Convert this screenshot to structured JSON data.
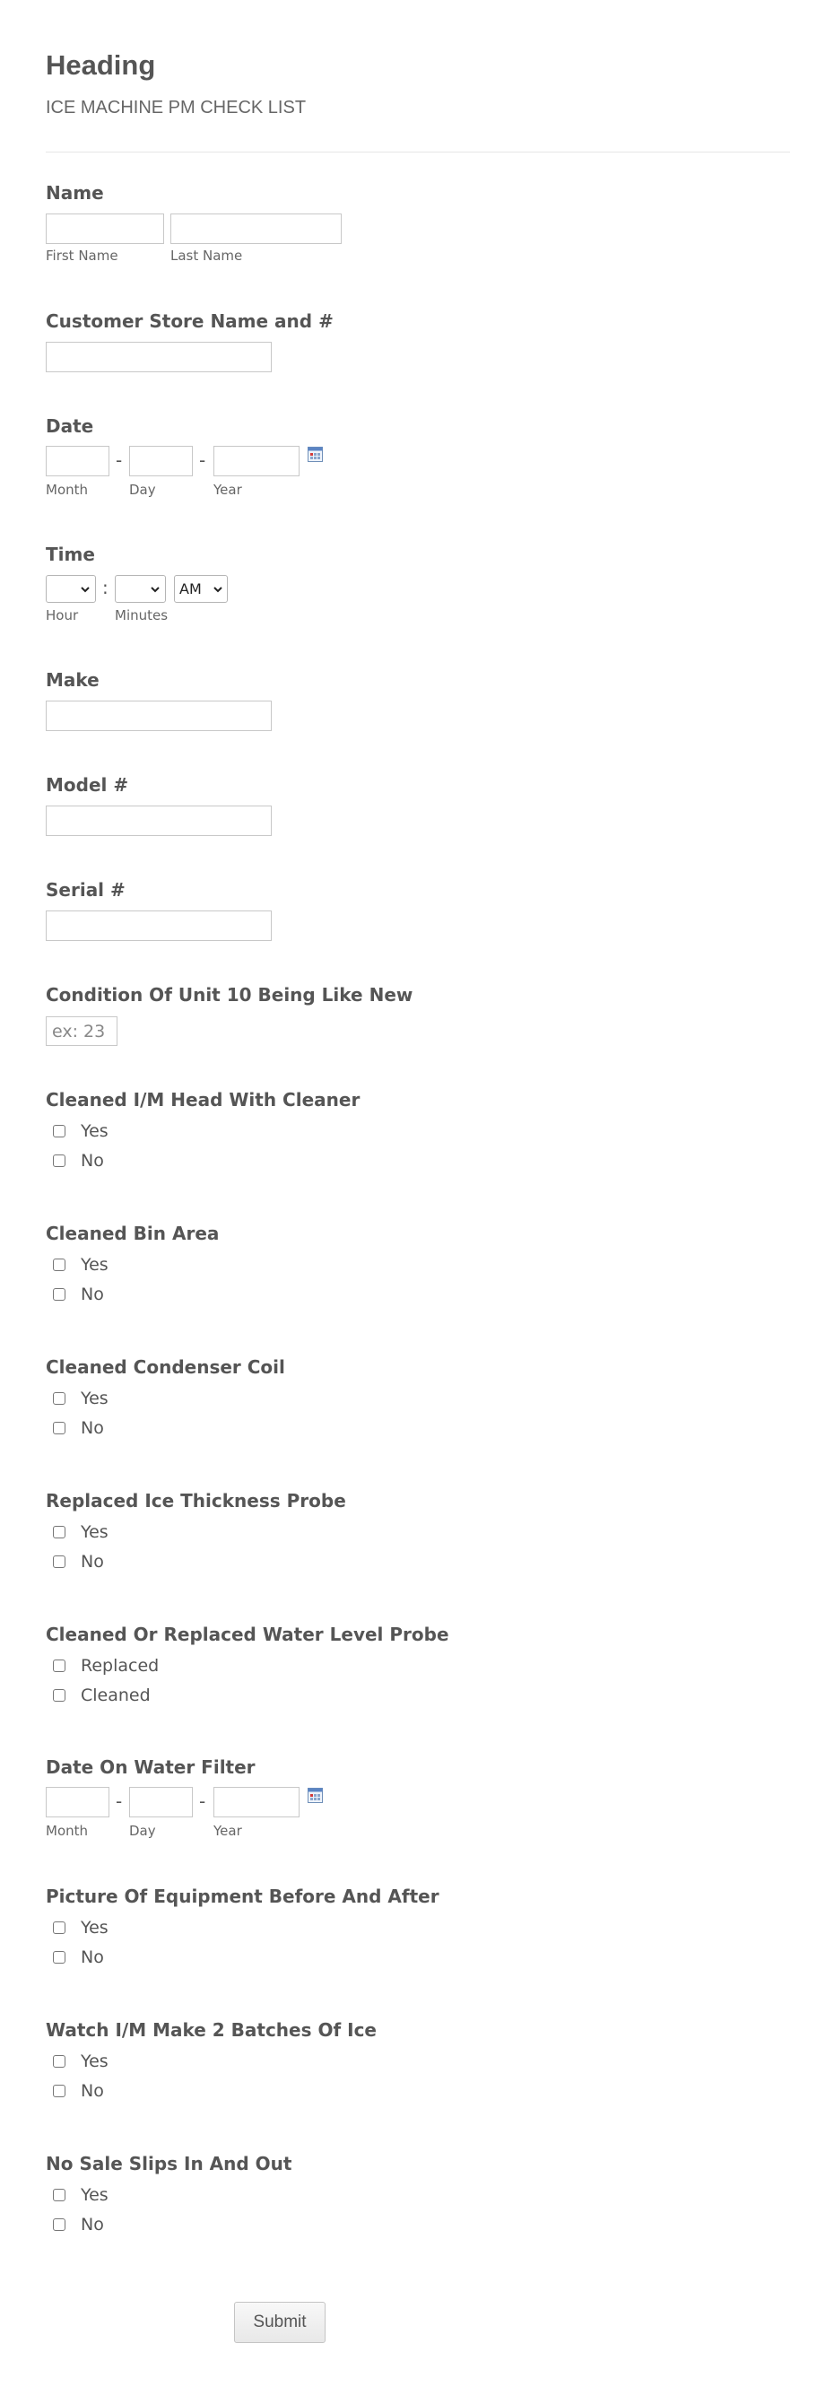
{
  "header": {
    "heading": "Heading",
    "subheading": "ICE MACHINE PM CHECK LIST"
  },
  "name": {
    "label": "Name",
    "first_sub": "First Name",
    "last_sub": "Last Name"
  },
  "store": {
    "label": "Customer Store Name and #"
  },
  "date": {
    "label": "Date",
    "sep1": "-",
    "sep2": "-",
    "month_sub": "Month",
    "day_sub": "Day",
    "year_sub": "Year",
    "icon": "calendar-icon"
  },
  "time": {
    "label": "Time",
    "sep": ":",
    "hour_sub": "Hour",
    "minutes_sub": "Minutes",
    "hour_value": "",
    "minutes_value": "",
    "ampm_value": "AM"
  },
  "make": {
    "label": "Make"
  },
  "model": {
    "label": "Model #"
  },
  "serial": {
    "label": "Serial #"
  },
  "condition": {
    "label": "Condition Of Unit 10 Being Like New",
    "placeholder": "ex: 23"
  },
  "q_head": {
    "label": "Cleaned I/M Head With Cleaner",
    "options": [
      "Yes",
      "No"
    ]
  },
  "q_bin": {
    "label": "Cleaned Bin Area",
    "options": [
      "Yes",
      "No"
    ]
  },
  "q_coil": {
    "label": "Cleaned Condenser Coil",
    "options": [
      "Yes",
      "No"
    ]
  },
  "q_probe": {
    "label": "Replaced Ice Thickness Probe",
    "options": [
      "Yes",
      "No"
    ]
  },
  "q_water": {
    "label": "Cleaned Or Replaced Water Level Probe",
    "options": [
      "Replaced",
      "Cleaned"
    ]
  },
  "filter_date": {
    "label": "Date On Water Filter",
    "sep1": "-",
    "sep2": "-",
    "month_sub": "Month",
    "day_sub": "Day",
    "year_sub": "Year",
    "icon": "calendar-icon"
  },
  "q_picture": {
    "label": "Picture Of Equipment Before And After",
    "options": [
      "Yes",
      "No"
    ]
  },
  "q_batches": {
    "label": "Watch I/M Make 2 Batches Of Ice",
    "options": [
      "Yes",
      "No"
    ]
  },
  "q_slips": {
    "label": "No Sale Slips In And Out",
    "options": [
      "Yes",
      "No"
    ]
  },
  "submit": {
    "label": "Submit"
  }
}
